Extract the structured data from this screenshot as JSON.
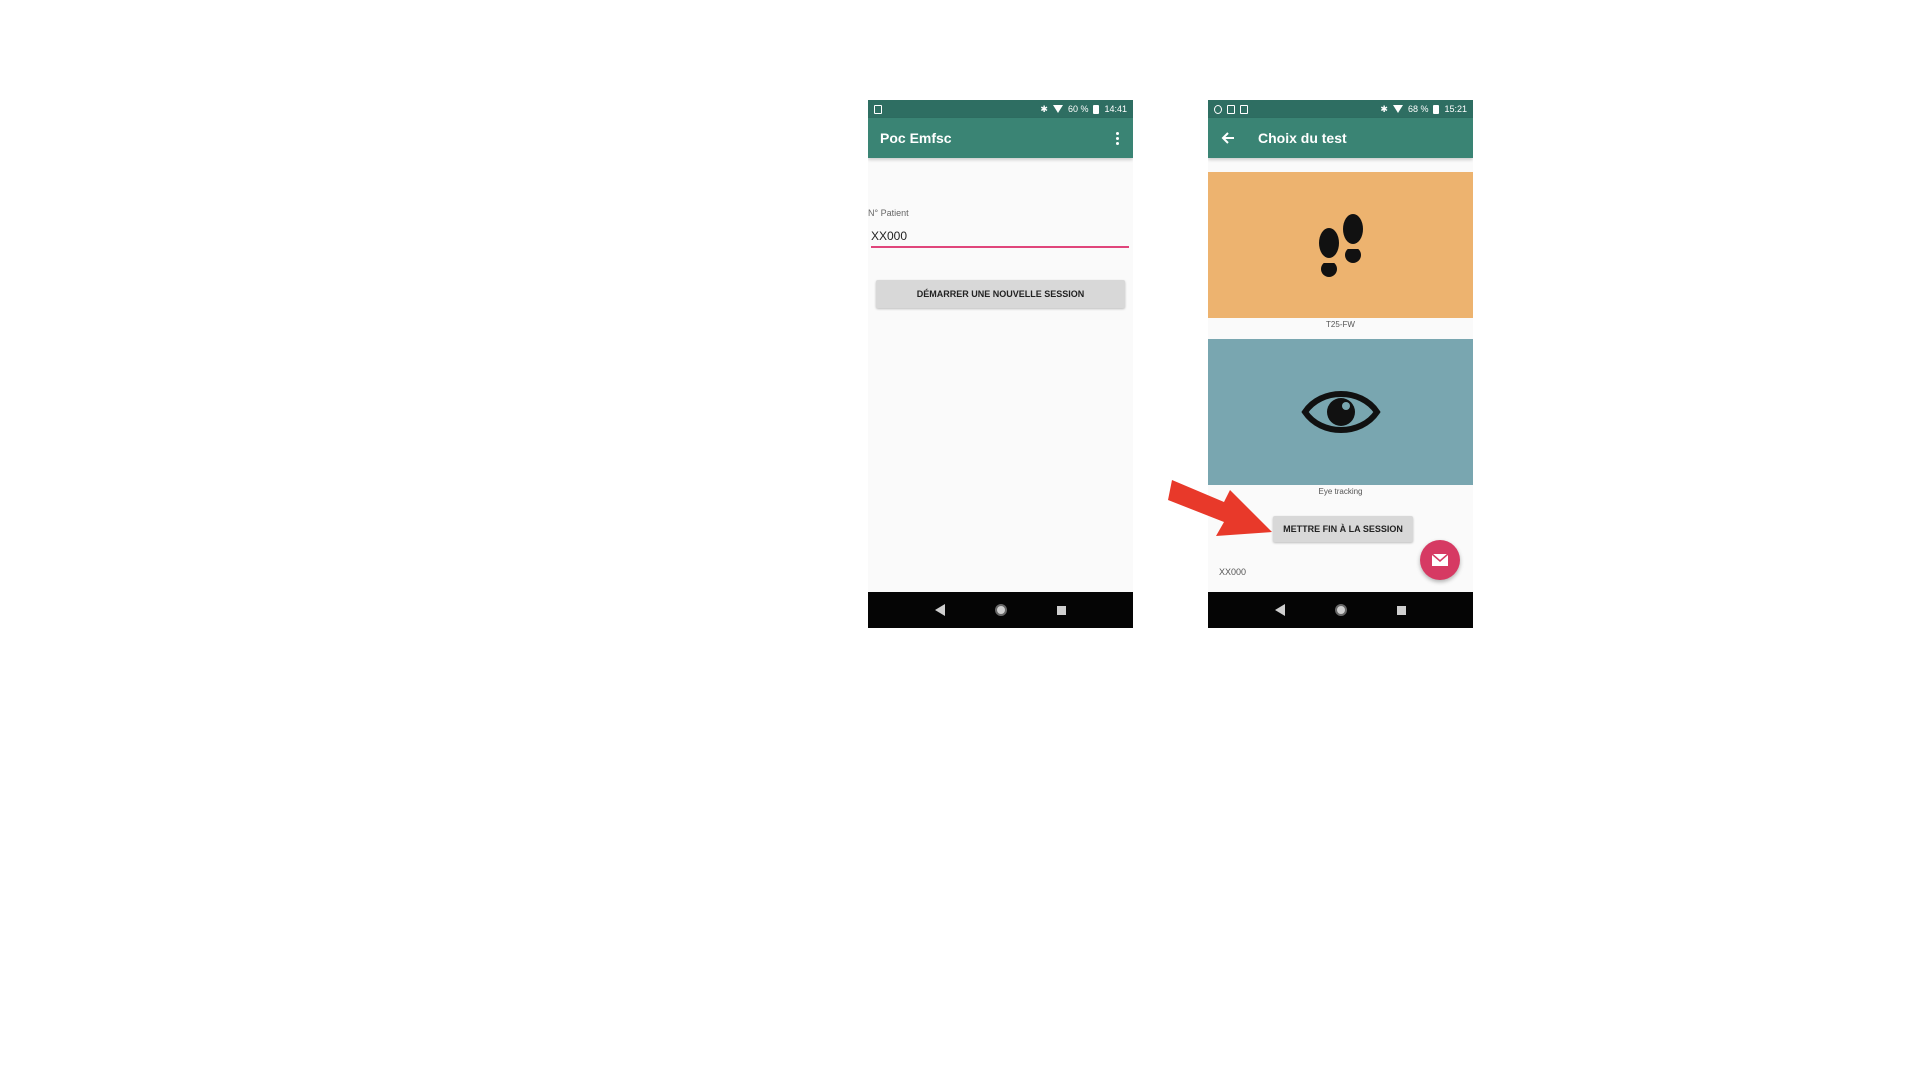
{
  "colors": {
    "status_bar": "#2e6e62",
    "app_bar": "#3a8474",
    "accent_underline": "#e0457b",
    "tile_walk": "#edb36f",
    "tile_eye": "#79a6b0",
    "fab": "#d63a63",
    "arrow": "#e8392a"
  },
  "screen1": {
    "status": {
      "right_text": "60 % ",
      "time": "14:41"
    },
    "app_bar": {
      "title": "Poc Emfsc",
      "menu_icon": "more-vert-icon"
    },
    "patient_field": {
      "label": "N° Patient",
      "value": "XX000"
    },
    "start_button": "DÉMARRER UNE NOUVELLE SESSION",
    "nav": {
      "back_icon": "nav-back-icon",
      "home_icon": "nav-home-icon",
      "recents_icon": "nav-recents-icon"
    }
  },
  "screen2": {
    "status": {
      "right_text": "68 % ",
      "time": "15:21"
    },
    "app_bar": {
      "title": "Choix du test",
      "back_icon": "arrow-back-icon"
    },
    "tests": [
      {
        "caption": "T25-FW",
        "icon": "footprints-icon"
      },
      {
        "caption": "Eye tracking",
        "icon": "eye-icon"
      }
    ],
    "end_button": "METTRE FIN À LA SESSION",
    "patient_id": "XX000",
    "fab_icon": "mail-icon",
    "nav": {
      "back_icon": "nav-back-icon",
      "home_icon": "nav-home-icon",
      "recents_icon": "nav-recents-icon"
    }
  }
}
